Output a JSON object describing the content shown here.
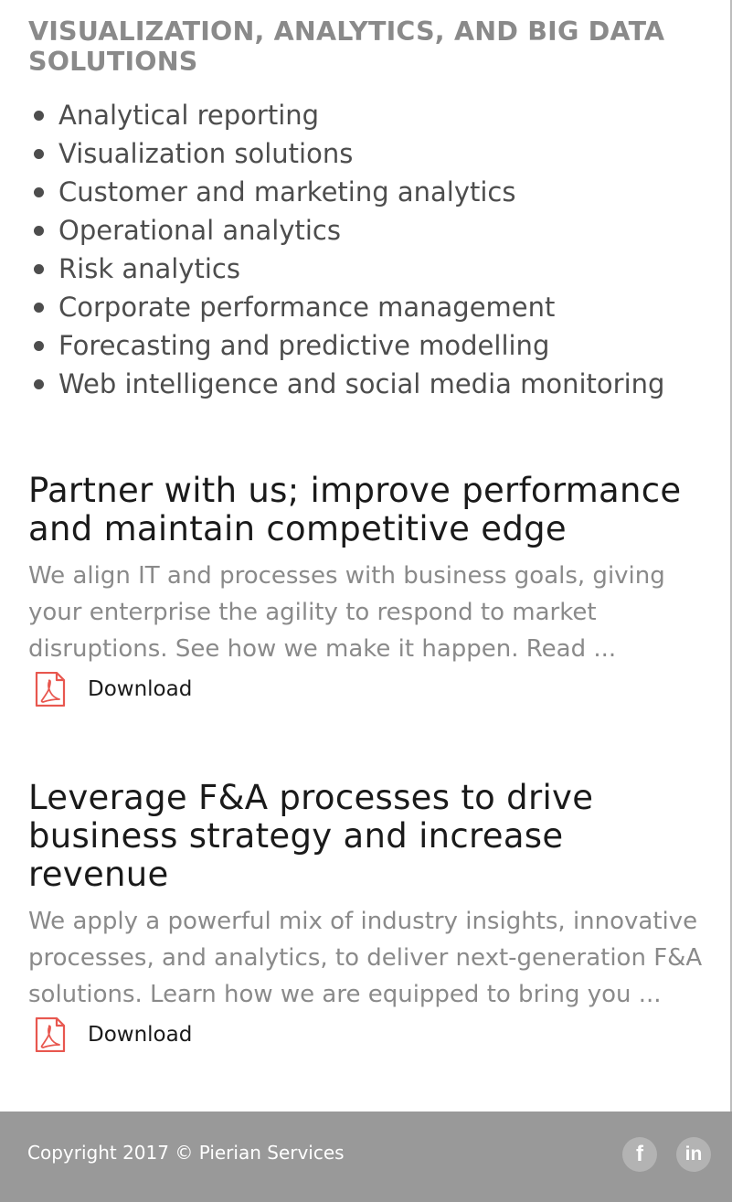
{
  "section": {
    "heading": "VISUALIZATION, ANALYTICS, AND BIG DATA SOLUTIONS",
    "items": [
      "Analytical reporting",
      "Visualization solutions",
      "Customer and marketing analytics",
      "Operational analytics",
      "Risk analytics",
      "Corporate performance management",
      "Forecasting and predictive modelling",
      "Web intelligence and social media monitoring"
    ]
  },
  "cards": [
    {
      "title": "Partner with us; improve performance and maintain competitive edge",
      "description": "We align IT and processes with business goals, giving your enterprise the agility to respond to market disruptions. See how we make it happen. Read ...",
      "download_label": "Download",
      "icon": "pdf-icon"
    },
    {
      "title": "Leverage F&A processes to drive business strategy and increase revenue",
      "description": "We apply a powerful mix of industry insights, innovative processes, and analytics, to deliver next-generation F&A solutions. Learn how we are equipped to bring you ...",
      "download_label": "Download",
      "icon": "pdf-icon"
    }
  ],
  "footer": {
    "copyright": "Copyright 2017 © Pierian Services",
    "social": [
      {
        "glyph": "f",
        "icon": "facebook-icon"
      },
      {
        "glyph": "in",
        "icon": "linkedin-icon"
      }
    ]
  },
  "colors": {
    "heading_gray": "#8a8a8a",
    "body_text": "#4d4d4d",
    "title_text": "#1a1a1a",
    "pdf_red": "#e8574f",
    "footer_bg": "#999999",
    "social_bg": "#b3b3b3"
  }
}
